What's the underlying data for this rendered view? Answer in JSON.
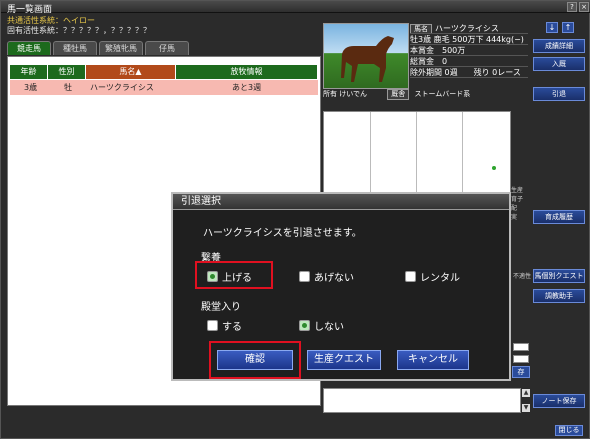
{
  "window": {
    "title": "馬一覧画面",
    "help": "?",
    "close": "×"
  },
  "lineage": {
    "common": "共通活性系統：ヘイロー",
    "unique": "固有活性系統：？？？？？，？？？？？"
  },
  "tabs": [
    "競走馬",
    "種牡馬",
    "繁殖牝馬",
    "仔馬"
  ],
  "table": {
    "headers": [
      "年齢",
      "性別",
      "馬名▲",
      "放牧情報"
    ],
    "rows": [
      {
        "age": "3歳",
        "sex": "牡",
        "name": "ハーツクライシス",
        "info": "あと3週"
      }
    ]
  },
  "horse": {
    "name_tag": "馬名",
    "name": "ハーツクライシス",
    "line1": "牡3歳 鹿毛 500万下 444kg(−)",
    "line2": "本賞金　500万",
    "line3": "総賞金　0",
    "line4": "除外期間 0週　　残り 0レース",
    "owner": "所有 けいでん",
    "stable_tag": "厩舎",
    "stable": "ストームバード系"
  },
  "legend": [
    "生産",
    "育子",
    "配",
    "実"
  ],
  "side_buttons": [
    "成績詳細",
    "入厩",
    "引退",
    "育成履歴",
    "馬個別クエスト",
    "調教助手",
    "ノート保存"
  ],
  "partial_labels": {
    "a": "不適性",
    "b": "存"
  },
  "updown": {
    "down": "↓",
    "up": "↑"
  },
  "close_button": "閉じる",
  "dialog": {
    "title": "引退選択",
    "message": "ハーツクライシスを引退させます。",
    "section1": "繋養",
    "options1": [
      "上げる",
      "あげない",
      "レンタル"
    ],
    "section2": "殿堂入り",
    "options2": [
      "する",
      "しない"
    ],
    "buttons": {
      "confirm": "確認",
      "quest": "生産クエスト",
      "cancel": "キャンセル"
    }
  },
  "colors": {
    "highlight": "#e01020",
    "accent_green": "#1d6a1d",
    "button_blue": "#2a4b9a"
  }
}
